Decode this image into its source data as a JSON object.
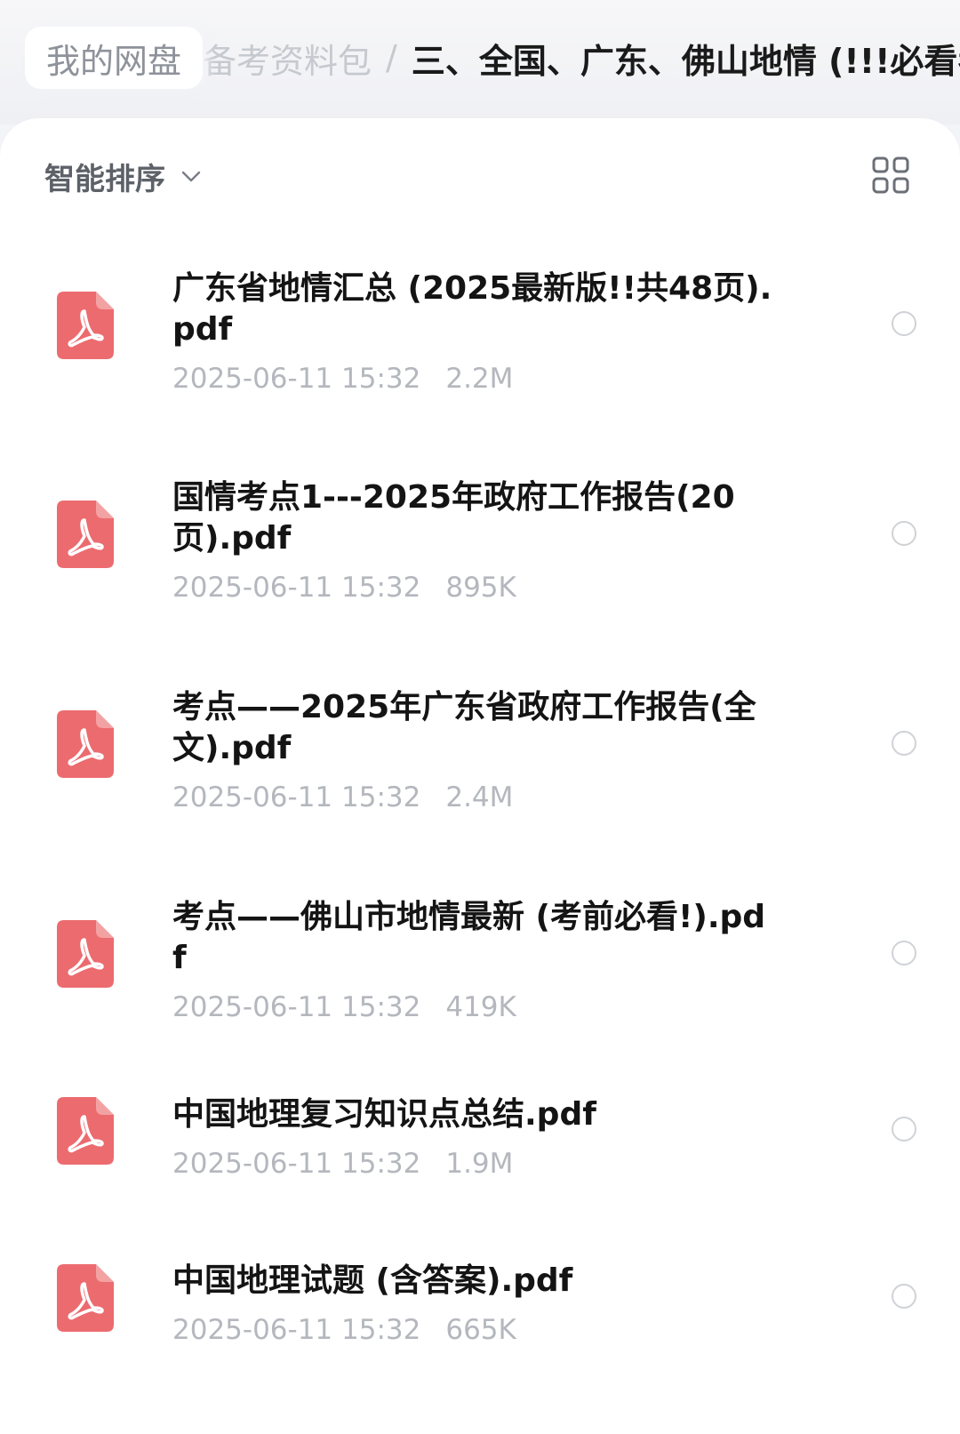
{
  "breadcrumb": {
    "root_label": "我的网盘",
    "parent_label": "备考资料包",
    "separator": "/",
    "current_label": "三、全国、广东、佛山地情 (!!!必看考点)"
  },
  "toolbar": {
    "sort_label": "智能排序",
    "sort_icon": "chevron-down-icon",
    "view_toggle_icon": "grid-view-icon"
  },
  "files": [
    {
      "name": "广东省地情汇总 (2025最新版!!共48页).pdf",
      "date": "2025-06-11 15:32",
      "size": "2.2M",
      "icon": "pdf-icon"
    },
    {
      "name": "国情考点1---2025年政府工作报告(20页).pdf",
      "date": "2025-06-11 15:32",
      "size": "895K",
      "icon": "pdf-icon"
    },
    {
      "name": "考点——2025年广东省政府工作报告(全文).pdf",
      "date": "2025-06-11 15:32",
      "size": "2.4M",
      "icon": "pdf-icon"
    },
    {
      "name": "考点——佛山市地情最新 (考前必看!).pdf",
      "date": "2025-06-11 15:32",
      "size": "419K",
      "icon": "pdf-icon"
    },
    {
      "name": "中国地理复习知识点总结.pdf",
      "date": "2025-06-11 15:32",
      "size": "1.9M",
      "icon": "pdf-icon"
    },
    {
      "name": "中国地理试题 (含答案).pdf",
      "date": "2025-06-11 15:32",
      "size": "665K",
      "icon": "pdf-icon"
    }
  ],
  "colors": {
    "pdf_icon": "#ec6b6f",
    "background": "#f3f4f7",
    "panel": "#ffffff",
    "meta_text": "#b4b7bd",
    "radio_border": "#d0d2d6"
  }
}
